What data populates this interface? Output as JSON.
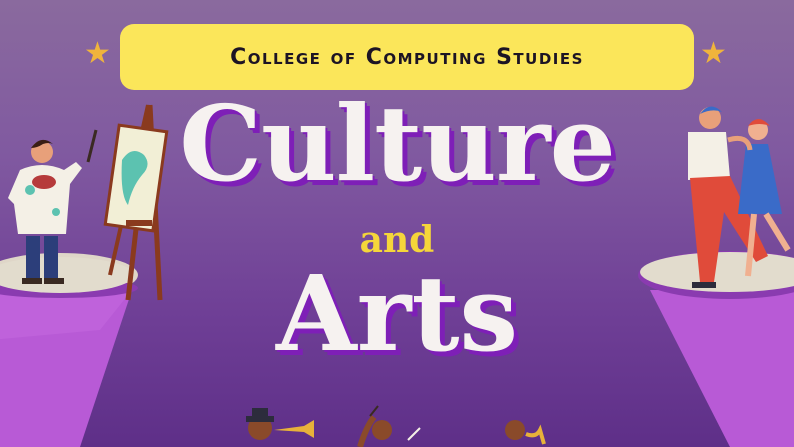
{
  "banner": {
    "text": "College of Computing Studies"
  },
  "title": {
    "line1": "Culture",
    "connector": "and",
    "line2": "Arts"
  },
  "icons": {
    "left_star": "star-icon",
    "right_star": "star-icon",
    "painter": "painter-illustration",
    "dancers": "dancing-couple-illustration",
    "musicians": "musicians-illustration"
  },
  "colors": {
    "banner": "#fbe65a",
    "accent_purple": "#7e1fb7",
    "title": "#f6f2f0",
    "connector": "#f5d63a",
    "star": "#f0b43c"
  }
}
